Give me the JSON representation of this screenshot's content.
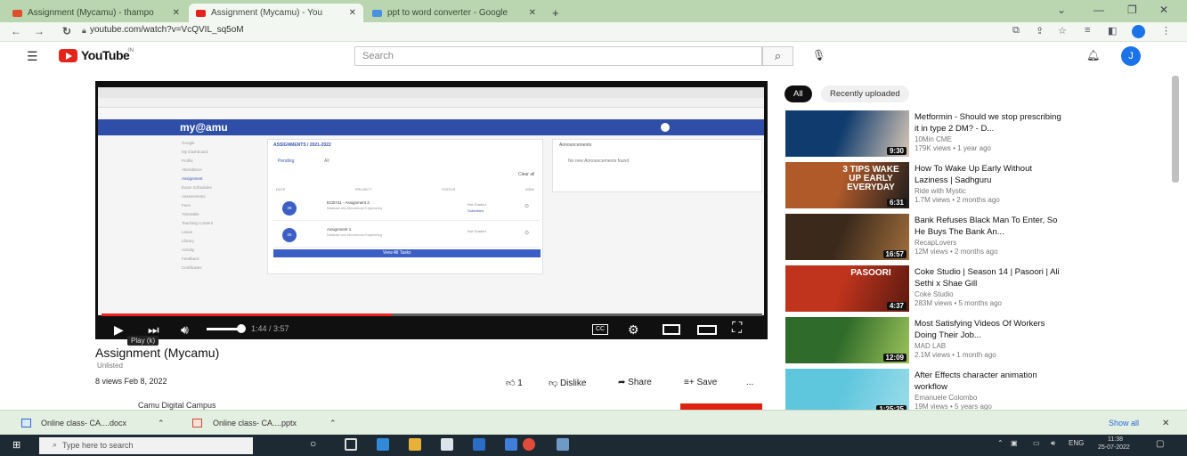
{
  "browser": {
    "tabs": [
      {
        "label": "Assignment (Mycamu) - thampo",
        "fav": "#e04f2b",
        "active": false
      },
      {
        "label": "Assignment (Mycamu) - You",
        "fav": "#e3231c",
        "active": true
      },
      {
        "label": "ppt to word converter - Google",
        "fav": "#4a90e2",
        "active": false
      }
    ],
    "new_tab": "+",
    "url": "youtube.com/watch?v=VcQVIL_sq5oM"
  },
  "youtube": {
    "logo_text": "YouTube",
    "logo_suffix": "IN",
    "search_placeholder": "Search",
    "avatar_letter": "J"
  },
  "player": {
    "time": "1:44 / 3:57",
    "progress": 0.44,
    "tooltip": "Play (k)",
    "cc_label": "CC",
    "embedded": {
      "brand": "my@amu",
      "title": "ASSIGNMENTS / 2021-2022",
      "tabs": [
        "Pending",
        "All"
      ],
      "clear_all": "Clear all",
      "announcements": "Announcements",
      "no_announcements": "No new Announcements found",
      "columns": [
        "DATE",
        "PROJECT",
        "STATUS",
        "VIEW"
      ],
      "rows": [
        {
          "day": "28",
          "project": "ECB741 - Assignment 3",
          "sub": "Database and Microservice Engineering",
          "status": "Not Graded",
          "status2": "Submitted"
        },
        {
          "day": "26",
          "project": "Assignment 1",
          "sub": "Database and Microservice Engineering",
          "status": "Not Graded",
          "status2": ""
        }
      ],
      "view_all": "View All Tasks",
      "menu": [
        "Google",
        "My Dashboard",
        "Profile",
        "Attendance",
        "Assignment",
        "Exam Schedules",
        "Assessments",
        "Fees",
        "Timetable",
        "Teaching Content",
        "Leave",
        "Library",
        "Activity",
        "Feedback",
        "Certificates"
      ]
    }
  },
  "video": {
    "title": "Assignment (Mycamu)",
    "unlisted": "Unlisted",
    "views": "8 views  Feb 8, 2022",
    "likes": "1",
    "dislike": "Dislike",
    "share": "Share",
    "save": "Save",
    "more": "...",
    "channel": "Camu Digital Campus"
  },
  "sidebar": {
    "chips": [
      "All",
      "Recently uploaded"
    ],
    "items": [
      {
        "title": "Metformin - Should we stop prescribing it in type 2 DM? - D...",
        "channel": "10Min CME",
        "meta": "179K views • 1 year ago",
        "duration": "9:30",
        "thumb_a": "#0f3b6e",
        "thumb_b": "#d9c8b6",
        "thumb_text": ""
      },
      {
        "title": "How To Wake Up Early Without Laziness | Sadhguru",
        "channel": "Ride with Mystic",
        "meta": "1.7M views • 2 months ago",
        "duration": "6:31",
        "thumb_a": "#b05a2a",
        "thumb_b": "#1d1d1d",
        "thumb_text": "3 TIPS WAKE UP EARLY EVERYDAY"
      },
      {
        "title": "Bank Refuses Black Man To Enter, So He Buys The Bank An...",
        "channel": "RecapLovers",
        "meta": "12M views • 2 months ago",
        "duration": "16:57",
        "thumb_a": "#3b2a1c",
        "thumb_b": "#a06d3b",
        "thumb_text": ""
      },
      {
        "title": "Coke Studio | Season 14 | Pasoori | Ali Sethi x Shae Gill",
        "channel": "Coke Studio",
        "meta": "283M views • 5 months ago",
        "duration": "4:37",
        "thumb_a": "#c0341d",
        "thumb_b": "#5a1a0f",
        "thumb_text": "PASOORI"
      },
      {
        "title": "Most Satisfying Videos Of Workers Doing Their Job...",
        "channel": "MAD LAB",
        "meta": "2.1M views • 1 month ago",
        "duration": "12:09",
        "thumb_a": "#2f6b2a",
        "thumb_b": "#9cc35a",
        "thumb_text": ""
      },
      {
        "title": "After Effects character animation workflow",
        "channel": "Emanuele Colombo",
        "meta": "19M views • 5 years ago",
        "duration": "1:25:25",
        "thumb_a": "#5ec6dd",
        "thumb_b": "#9adcea",
        "thumb_text": ""
      }
    ]
  },
  "downloads": {
    "items": [
      "Online class- CA....docx",
      "Online class- CA....pptx"
    ],
    "show_all": "Show all",
    "close": "✕"
  },
  "taskbar": {
    "search_placeholder": "Type here to search",
    "lang": "ENG",
    "time": "11:38",
    "date": "25-07-2022"
  }
}
